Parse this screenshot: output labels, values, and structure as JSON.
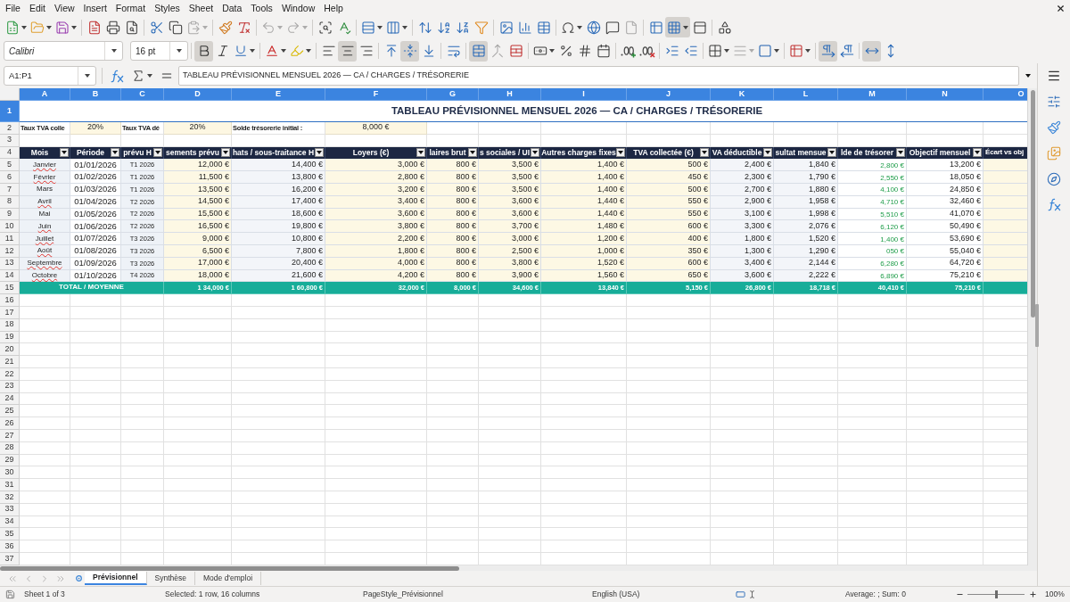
{
  "menu_bar": [
    "File",
    "Edit",
    "View",
    "Insert",
    "Format",
    "Styles",
    "Sheet",
    "Data",
    "Tools",
    "Window",
    "Help"
  ],
  "standard_toolbar": {
    "paste_disabled": true,
    "undo_disabled": true,
    "redo_disabled": true,
    "headers_footers_disabled": true,
    "freeze_active": true
  },
  "formatting_toolbar": {
    "font_name": "Calibri",
    "font_size": "16 pt",
    "bold": true,
    "italic": false,
    "underline": false,
    "align_left": false,
    "align_center": true,
    "align_right": false,
    "align_top": false,
    "align_middle": true,
    "align_bottom": false,
    "wrap_text": false,
    "merge_and_center": true,
    "merge_disabled": true,
    "border_style_disabled": true,
    "left_to_right": true,
    "right_to_left": false,
    "text_horizontal": true,
    "text_vertical": false
  },
  "formula_bar": {
    "name_box": "A1:P1",
    "content": "TABLEAU PRÉVISIONNEL MENSUEL 2026 — CA / CHARGES / TRÉSORERIE"
  },
  "sheet": {
    "columns": [
      {
        "label": "A",
        "selected": true
      },
      {
        "label": "B",
        "selected": true
      },
      {
        "label": "C",
        "selected": true
      },
      {
        "label": "D",
        "selected": true
      },
      {
        "label": "E",
        "selected": true
      },
      {
        "label": "F",
        "selected": true
      },
      {
        "label": "G",
        "selected": true
      },
      {
        "label": "H",
        "selected": true
      },
      {
        "label": "I",
        "selected": true
      },
      {
        "label": "J",
        "selected": true
      },
      {
        "label": "K",
        "selected": true
      },
      {
        "label": "L",
        "selected": true
      },
      {
        "label": "M",
        "selected": true
      },
      {
        "label": "N",
        "selected": true
      },
      {
        "label": "O",
        "selected": true
      }
    ],
    "rows": [
      {
        "number": "1",
        "selected": true,
        "kind": "title",
        "text": "TABLEAU PRÉVISIONNEL MENSUEL 2026 — CA / CHARGES / TRÉSORERIE"
      },
      {
        "number": "2",
        "selected": false,
        "kind": "parameters",
        "cells": [
          {
            "kind": "label",
            "text": "Taux TVA colle"
          },
          {
            "kind": "input",
            "text": "20%"
          },
          {
            "kind": "label",
            "text": "Taux TVA dé"
          },
          {
            "kind": "input",
            "text": "20%"
          },
          {
            "kind": "label",
            "text": "Solde trésorerie initial :"
          },
          {
            "kind": "input",
            "text": "8,000 €"
          }
        ]
      },
      {
        "number": "3",
        "selected": false,
        "kind": "empty"
      },
      {
        "number": "4",
        "selected": false,
        "kind": "header",
        "cells": [
          {
            "text": "Mois",
            "filter": true
          },
          {
            "text": "Période",
            "filter": true
          },
          {
            "text": "prévu H",
            "filter": true
          },
          {
            "text": "sements prévu",
            "filter": true
          },
          {
            "text": "hats / sous-traitance H",
            "filter": true
          },
          {
            "text": "Loyers (€)",
            "filter": true
          },
          {
            "text": "laires brut",
            "filter": true
          },
          {
            "text": "s sociales / UI",
            "filter": true
          },
          {
            "text": "Autres charges fixes",
            "filter": true
          },
          {
            "text": "TVA collectée (€)",
            "filter": true
          },
          {
            "text": "VA déductible",
            "filter": true
          },
          {
            "text": "sultat mensue",
            "filter": true
          },
          {
            "text": "lde de trésorer",
            "filter": true
          },
          {
            "text": "Objectif mensuel",
            "filter": true
          },
          {
            "text": "Écart vs obj",
            "filter": false
          }
        ]
      },
      {
        "number": "5",
        "selected": false,
        "kind": "data",
        "month": {
          "text": "Janvier",
          "misspelled": true
        },
        "cells": [
          "01/01/2026",
          "T1 2026",
          "12,000 €",
          "14,400 €",
          "3,000 €",
          "800 €",
          "3,500 €",
          "1,400 €",
          "500 €",
          "2,400 €",
          "1,840 €",
          "2,800 €",
          "13,200 €"
        ]
      },
      {
        "number": "6",
        "selected": false,
        "kind": "data",
        "month": {
          "text": "Février",
          "misspelled": true
        },
        "cells": [
          "01/02/2026",
          "T1 2026",
          "11,500 €",
          "13,800 €",
          "2,800 €",
          "800 €",
          "3,500 €",
          "1,400 €",
          "450 €",
          "2,300 €",
          "1,790 €",
          "2,550 €",
          "18,050 €"
        ]
      },
      {
        "number": "7",
        "selected": false,
        "kind": "data",
        "month": {
          "text": "Mars",
          "misspelled": false
        },
        "cells": [
          "01/03/2026",
          "T1 2026",
          "13,500 €",
          "16,200 €",
          "3,200 €",
          "800 €",
          "3,500 €",
          "1,400 €",
          "500 €",
          "2,700 €",
          "1,880 €",
          "4,100 €",
          "24,850 €"
        ]
      },
      {
        "number": "8",
        "selected": false,
        "kind": "data",
        "month": {
          "text": "Avril",
          "misspelled": true
        },
        "cells": [
          "01/04/2026",
          "T2 2026",
          "14,500 €",
          "17,400 €",
          "3,400 €",
          "800 €",
          "3,600 €",
          "1,440 €",
          "550 €",
          "2,900 €",
          "1,958 €",
          "4,710 €",
          "32,460 €"
        ]
      },
      {
        "number": "9",
        "selected": false,
        "kind": "data",
        "month": {
          "text": "Mai",
          "misspelled": false
        },
        "cells": [
          "01/05/2026",
          "T2 2026",
          "15,500 €",
          "18,600 €",
          "3,600 €",
          "800 €",
          "3,600 €",
          "1,440 €",
          "550 €",
          "3,100 €",
          "1,998 €",
          "5,510 €",
          "41,070 €"
        ]
      },
      {
        "number": "10",
        "selected": false,
        "kind": "data",
        "month": {
          "text": "Juin",
          "misspelled": true
        },
        "cells": [
          "01/06/2026",
          "T2 2026",
          "16,500 €",
          "19,800 €",
          "3,800 €",
          "800 €",
          "3,700 €",
          "1,480 €",
          "600 €",
          "3,300 €",
          "2,076 €",
          "6,120 €",
          "50,490 €"
        ]
      },
      {
        "number": "11",
        "selected": false,
        "kind": "data",
        "month": {
          "text": "Juillet",
          "misspelled": true
        },
        "cells": [
          "01/07/2026",
          "T3 2026",
          "9,000 €",
          "10,800 €",
          "2,200 €",
          "800 €",
          "3,000 €",
          "1,200 €",
          "400 €",
          "1,800 €",
          "1,520 €",
          "1,400 €",
          "53,690 €"
        ]
      },
      {
        "number": "12",
        "selected": false,
        "kind": "data",
        "month": {
          "text": "Août",
          "misspelled": true
        },
        "cells": [
          "01/08/2026",
          "T3 2026",
          "6,500 €",
          "7,800 €",
          "1,800 €",
          "800 €",
          "2,500 €",
          "1,000 €",
          "350 €",
          "1,300 €",
          "1,290 €",
          "050 €",
          "55,040 €"
        ]
      },
      {
        "number": "13",
        "selected": false,
        "kind": "data",
        "month": {
          "text": "Septembre",
          "misspelled": true
        },
        "cells": [
          "01/09/2026",
          "T3 2026",
          "17,000 €",
          "20,400 €",
          "4,000 €",
          "800 €",
          "3,800 €",
          "1,520 €",
          "600 €",
          "3,400 €",
          "2,144 €",
          "6,280 €",
          "64,720 €"
        ]
      },
      {
        "number": "14",
        "selected": false,
        "kind": "data",
        "month": {
          "text": "Octobre",
          "misspelled": true
        },
        "cells": [
          "01/10/2026",
          "T4 2026",
          "18,000 €",
          "21,600 €",
          "4,200 €",
          "800 €",
          "3,900 €",
          "1,560 €",
          "650 €",
          "3,600 €",
          "2,222 €",
          "6,890 €",
          "75,210 €"
        ]
      },
      {
        "number": "15",
        "selected": false,
        "kind": "total",
        "label": "TOTAL / MOYENNE",
        "cells": [
          "1 34,000 €",
          "1 60,800 €",
          "32,000 €",
          "8,000 €",
          "34,600 €",
          "13,840 €",
          "5,150 €",
          "26,800 €",
          "18,718 €",
          "40,410 €",
          "75,210 €"
        ]
      },
      {
        "number": "16",
        "selected": false,
        "kind": "empty"
      },
      {
        "number": "17",
        "selected": false,
        "kind": "empty"
      },
      {
        "number": "18",
        "selected": false,
        "kind": "empty"
      },
      {
        "number": "19",
        "selected": false,
        "kind": "empty"
      },
      {
        "number": "20",
        "selected": false,
        "kind": "empty"
      },
      {
        "number": "21",
        "selected": false,
        "kind": "empty"
      },
      {
        "number": "22",
        "selected": false,
        "kind": "empty"
      },
      {
        "number": "23",
        "selected": false,
        "kind": "empty"
      },
      {
        "number": "24",
        "selected": false,
        "kind": "empty"
      },
      {
        "number": "25",
        "selected": false,
        "kind": "empty"
      },
      {
        "number": "26",
        "selected": false,
        "kind": "empty"
      },
      {
        "number": "27",
        "selected": false,
        "kind": "empty"
      },
      {
        "number": "28",
        "selected": false,
        "kind": "empty"
      },
      {
        "number": "29",
        "selected": false,
        "kind": "empty"
      },
      {
        "number": "30",
        "selected": false,
        "kind": "empty"
      },
      {
        "number": "31",
        "selected": false,
        "kind": "empty"
      },
      {
        "number": "32",
        "selected": false,
        "kind": "empty"
      },
      {
        "number": "33",
        "selected": false,
        "kind": "empty"
      },
      {
        "number": "34",
        "selected": false,
        "kind": "empty"
      },
      {
        "number": "35",
        "selected": false,
        "kind": "empty"
      },
      {
        "number": "36",
        "selected": false,
        "kind": "empty"
      },
      {
        "number": "37",
        "selected": false,
        "kind": "empty"
      }
    ]
  },
  "sheet_tabs": {
    "navigation_disabled": true,
    "tabs": [
      {
        "label": "Prévisionnel",
        "selected": true
      },
      {
        "label": "Synthèse",
        "selected": false
      },
      {
        "label": "Mode d'emploi",
        "selected": false
      }
    ]
  },
  "status_bar": {
    "sheet_position": "Sheet 1 of 3",
    "selection": "Selected: 1 row, 16 columns",
    "page_style": "PageStyle_Prévisionnel",
    "language": "English (USA)",
    "summary": "Average: ; Sum: 0",
    "zoom_slider": {
      "level": 0.5
    },
    "zoom": "100%"
  }
}
